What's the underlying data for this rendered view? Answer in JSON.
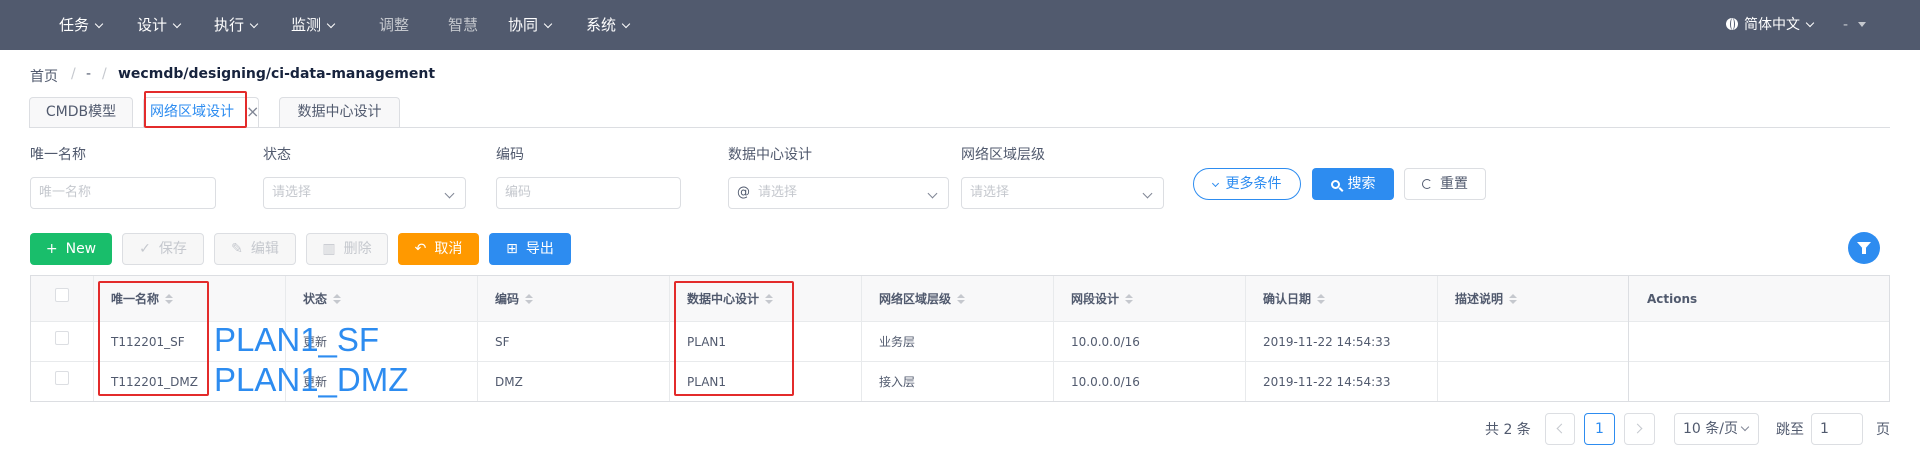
{
  "nav": {
    "items": [
      {
        "label": "任务",
        "has_dropdown": true
      },
      {
        "label": "设计",
        "has_dropdown": true
      },
      {
        "label": "执行",
        "has_dropdown": true
      },
      {
        "label": "监测",
        "has_dropdown": true
      },
      {
        "label": "调整",
        "has_dropdown": false
      },
      {
        "label": "智慧",
        "has_dropdown": false
      },
      {
        "label": "协同",
        "has_dropdown": true
      },
      {
        "label": "系统",
        "has_dropdown": true
      }
    ],
    "language": "简体中文",
    "user": "-"
  },
  "breadcrumb": {
    "home": "首页",
    "sep": "/",
    "middle": "-",
    "current": "wecmdb/designing/ci-data-management"
  },
  "tabs": [
    {
      "label": "CMDB模型",
      "active": false
    },
    {
      "label": "网络区域设计",
      "active": true,
      "close": "×"
    },
    {
      "label": "数据中心设计",
      "active": false
    }
  ],
  "filters": {
    "fields": [
      {
        "label": "唯一名称",
        "placeholder": "唯一名称",
        "type": "input"
      },
      {
        "label": "状态",
        "placeholder": "请选择",
        "type": "select"
      },
      {
        "label": "编码",
        "placeholder": "编码",
        "type": "input"
      },
      {
        "label": "数据中心设计",
        "placeholder": "请选择",
        "type": "select",
        "prefix": "@"
      },
      {
        "label": "网络区域层级",
        "placeholder": "请选择",
        "type": "select"
      }
    ],
    "more_label": "更多条件",
    "search_label": "搜索",
    "reset_label": "重置"
  },
  "actions": {
    "new_label": "New",
    "save_label": "保存",
    "edit_label": "编辑",
    "delete_label": "删除",
    "cancel_label": "取消",
    "export_label": "导出"
  },
  "table": {
    "columns": [
      "唯一名称",
      "状态",
      "编码",
      "数据中心设计",
      "网络区域层级",
      "网段设计",
      "确认日期",
      "描述说明",
      "Actions"
    ],
    "rows": [
      {
        "name": "T112201_SF",
        "status": "更新",
        "code": "SF",
        "dc": "PLAN1",
        "level": "业务层",
        "segment": "10.0.0.0/16",
        "date": "2019-11-22 14:54:33",
        "desc": ""
      },
      {
        "name": "T112201_DMZ",
        "status": "更新",
        "code": "DMZ",
        "dc": "PLAN1",
        "level": "接入层",
        "segment": "10.0.0.0/16",
        "date": "2019-11-22 14:54:33",
        "desc": ""
      }
    ]
  },
  "overlays": [
    "PLAN1_SF",
    "PLAN1_DMZ"
  ],
  "pagination": {
    "total": "共 2 条",
    "current_page": "1",
    "page_size": "10 条/页",
    "jump_label": "跳至",
    "jump_value": "1",
    "page_suffix": "页"
  },
  "colors": {
    "nav_bg": "#515a6e",
    "primary": "#2d8cf0",
    "success": "#19be6b",
    "warning": "#ff9900",
    "highlight": "#e32b2b"
  },
  "icons": {
    "search": "magnifier-icon",
    "reset": "refresh-icon",
    "filter": "funnel-icon",
    "language": "globe-icon"
  }
}
